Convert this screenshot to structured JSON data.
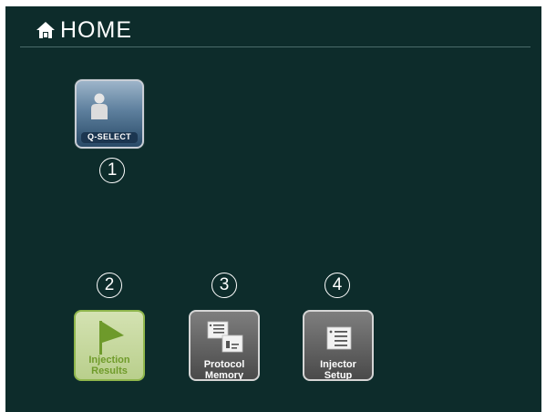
{
  "header": {
    "title": "HOME",
    "icon": "home-icon"
  },
  "tiles": {
    "qselect": {
      "label": "Q-SELECT",
      "icon": "person-icon",
      "number": "1"
    },
    "results": {
      "label_line1": "Injection",
      "label_line2": "Results",
      "icon": "flag-icon",
      "number": "2"
    },
    "protocol": {
      "label_line1": "Protocol",
      "label_line2": "Memory",
      "icon": "protocol-memory-icon",
      "number": "3"
    },
    "injector": {
      "label_line1": "Injector",
      "label_line2": "Setup",
      "icon": "injector-setup-icon",
      "number": "4"
    }
  },
  "colors": {
    "background": "#0d2c2b",
    "results_accent": "#8fb64c",
    "qselect_accent": "#294a67"
  }
}
